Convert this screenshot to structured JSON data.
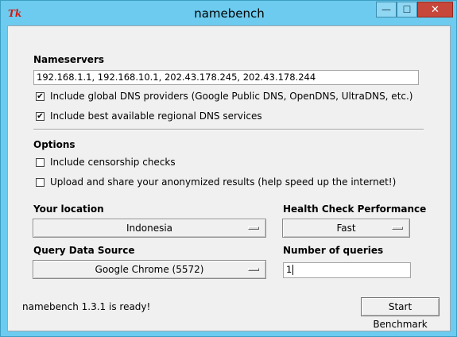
{
  "window": {
    "title": "namebench",
    "icon": "tk-feather-icon",
    "controls": {
      "minimize": "—",
      "maximize": "☐",
      "close": "✕"
    }
  },
  "nameservers": {
    "label": "Nameservers",
    "value": "192.168.1.1, 192.168.10.1, 202.43.178.245, 202.43.178.244",
    "include_global": {
      "label": "Include global DNS providers (Google Public DNS, OpenDNS, UltraDNS, etc.)",
      "checked": true
    },
    "include_regional": {
      "label": "Include best available regional DNS services",
      "checked": true
    }
  },
  "options": {
    "label": "Options",
    "censorship": {
      "label": "Include censorship checks",
      "checked": false
    },
    "upload": {
      "label": "Upload and share your anonymized results (help speed up the internet!)",
      "checked": false
    }
  },
  "location": {
    "label": "Your location",
    "value": "Indonesia"
  },
  "health": {
    "label": "Health Check Performance",
    "value": "Fast"
  },
  "query_source": {
    "label": "Query Data Source",
    "value": "Google Chrome (5572)"
  },
  "num_queries": {
    "label": "Number of queries",
    "value": "1"
  },
  "status": {
    "text": "namebench 1.3.1 is ready!"
  },
  "actions": {
    "start": "Start Benchmark"
  },
  "colors": {
    "titlebar": "#6ccbef",
    "close_button": "#c7473a",
    "client_bg": "#f0f0f0"
  }
}
